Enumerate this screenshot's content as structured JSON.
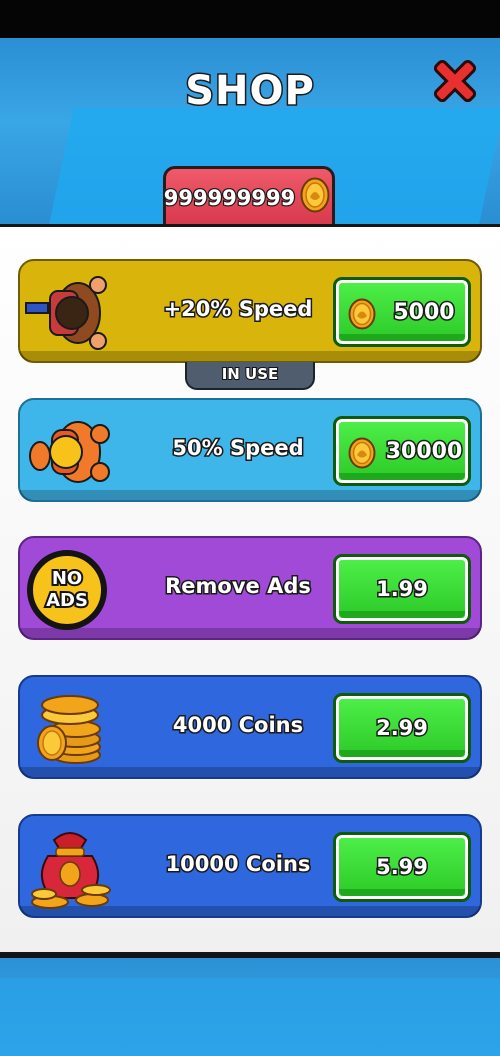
{
  "header": {
    "title": "SHOP",
    "close_icon": "close-x-icon",
    "balance": "999999999",
    "balance_icon": "coin-icon"
  },
  "items": [
    {
      "label": "+20% Speed",
      "price": "5000",
      "currency_icon": "coin-icon",
      "badge": "IN USE",
      "color": "#d9b50c",
      "icon": "speed-character-icon"
    },
    {
      "label": "50% Speed",
      "price": "30000",
      "currency_icon": "coin-icon",
      "color": "#3fb6ea",
      "icon": "speed-character-orange-icon"
    },
    {
      "label": "Remove Ads",
      "price": "1.99",
      "color": "#a24ad8",
      "icon": "no-ads-icon",
      "icon_text_1": "NO",
      "icon_text_2": "ADS"
    },
    {
      "label": "4000 Coins",
      "price": "2.99",
      "color": "#2f67de",
      "icon": "coin-stack-icon"
    },
    {
      "label": "10000 Coins",
      "price": "5.99",
      "color": "#2f67de",
      "icon": "coin-bag-icon"
    }
  ]
}
